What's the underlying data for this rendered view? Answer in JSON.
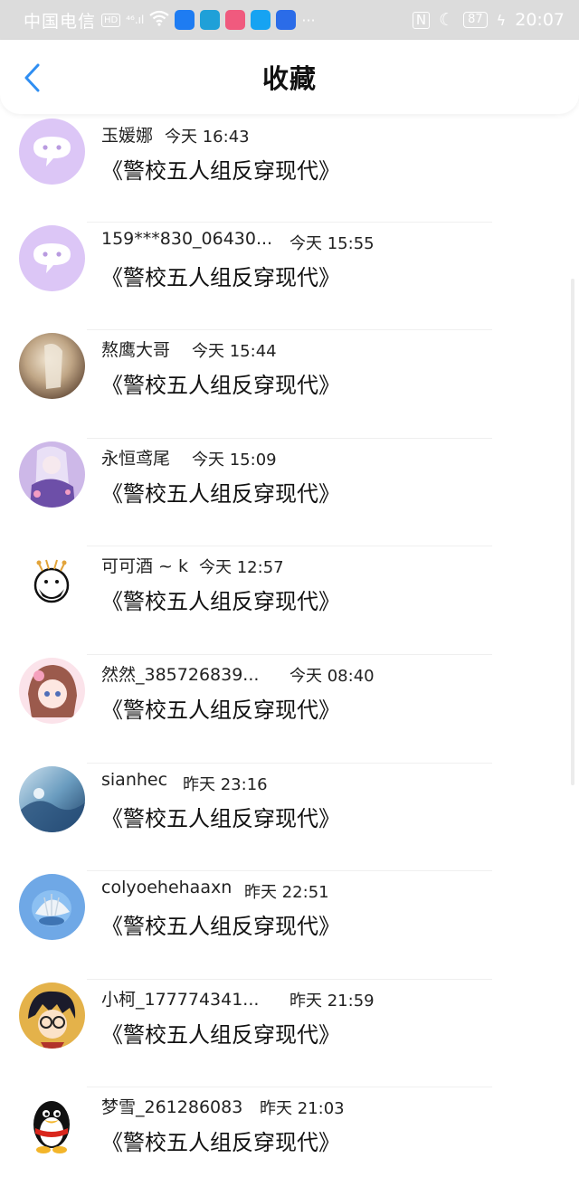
{
  "status_bar": {
    "carrier": "中国电信",
    "hd": "HD",
    "signal": "⁴⁶.ıl",
    "battery": "87",
    "time": "20:07",
    "dots": "···",
    "nfc": "N",
    "moon": "☾",
    "bolt": "ϟ",
    "app_colors": [
      "#1e7cf2",
      "#1fa0d8",
      "#f05a7e",
      "#16a3f2",
      "#2b6ce8"
    ]
  },
  "header": {
    "title": "收藏",
    "back_icon": "chevron-left-icon",
    "accent_color": "#2f8ef2"
  },
  "items": [
    {
      "name": "玉媛娜",
      "time": "今天 16:43",
      "book": "《警校五人组反穿现代》",
      "avatar": "chat-bubble"
    },
    {
      "name": "159***830_06430...",
      "time": "今天 15:55",
      "book": "《警校五人组反穿现代》",
      "avatar": "chat-bubble"
    },
    {
      "name": "熬鹰大哥",
      "time": "今天 15:44",
      "book": "《警校五人组反穿现代》",
      "avatar": "photo-warm"
    },
    {
      "name": "永恒鸢尾",
      "time": "今天 15:09",
      "book": "《警校五人组反穿现代》",
      "avatar": "anime-purple"
    },
    {
      "name": "可可酒 ~ k",
      "time": "今天 12:57",
      "book": "《警校五人组反穿现代》",
      "avatar": "cartoon-face"
    },
    {
      "name": "然然_385726839...",
      "time": "今天 08:40",
      "book": "《警校五人组反穿现代》",
      "avatar": "anime-pink"
    },
    {
      "name": "sianhec",
      "time": "昨天 23:16",
      "book": "《警校五人组反穿现代》",
      "avatar": "photo-blue"
    },
    {
      "name": "colyoehehaaxn",
      "time": "昨天 22:51",
      "book": "《警校五人组反穿现代》",
      "avatar": "shell-blue"
    },
    {
      "name": "小柯_177774341...",
      "time": "昨天 21:59",
      "book": "《警校五人组反穿现代》",
      "avatar": "anime-boy"
    },
    {
      "name": "梦雪_261286083",
      "time": "昨天 21:03",
      "book": "《警校五人组反穿现代》",
      "avatar": "penguin"
    }
  ]
}
